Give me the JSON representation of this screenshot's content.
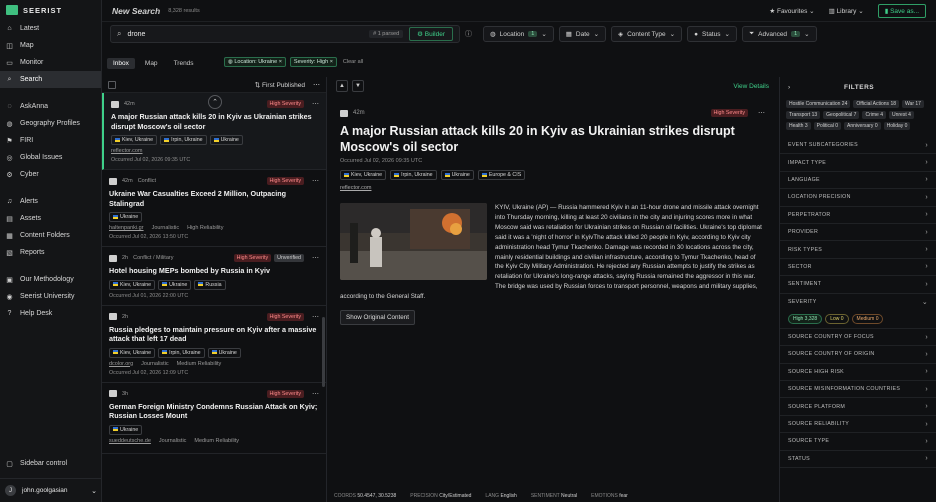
{
  "app": {
    "logo": "SEERIST"
  },
  "nav": {
    "items": [
      {
        "label": "Latest",
        "icon": "home-icon"
      },
      {
        "label": "Map",
        "icon": "map-icon"
      },
      {
        "label": "Monitor",
        "icon": "monitor-icon"
      },
      {
        "label": "Search",
        "icon": "search-icon"
      }
    ],
    "items2": [
      {
        "label": "AskAnna",
        "icon": "chat-icon"
      },
      {
        "label": "Geography Profiles",
        "icon": "globe-icon"
      },
      {
        "label": "FIRI",
        "icon": "flag-icon"
      },
      {
        "label": "Global Issues",
        "icon": "issues-icon"
      },
      {
        "label": "Cyber",
        "icon": "cyber-icon"
      }
    ],
    "items3": [
      {
        "label": "Alerts",
        "icon": "bell-icon"
      },
      {
        "label": "Assets",
        "icon": "asset-icon"
      },
      {
        "label": "Content Folders",
        "icon": "folder-icon"
      },
      {
        "label": "Reports",
        "icon": "report-icon"
      }
    ],
    "items4": [
      {
        "label": "Our Methodology",
        "icon": "book-icon"
      },
      {
        "label": "Seerist University",
        "icon": "university-icon"
      },
      {
        "label": "Help Desk",
        "icon": "help-icon"
      }
    ],
    "sidebar_control": "Sidebar control",
    "user_initial": "J",
    "user_name": "john.goolgasian"
  },
  "topbar": {
    "title": "New Search",
    "count": "8,328 results",
    "favourites": "Favourites",
    "library": "Library",
    "save": "Save as..."
  },
  "search": {
    "query": "drone",
    "parsed": "1 parsed",
    "builder": "Builder",
    "filters": [
      {
        "label": "Location",
        "count": "1"
      },
      {
        "label": "Date",
        "count": ""
      },
      {
        "label": "Content Type",
        "count": ""
      },
      {
        "label": "Status",
        "count": ""
      },
      {
        "label": "Advanced",
        "count": "1"
      }
    ]
  },
  "tabs": [
    "Inbox",
    "Map",
    "Trends"
  ],
  "active_filters": {
    "location": "Location: Ukraine",
    "severity": "Severity: High",
    "clear": "Clear all"
  },
  "list": {
    "sort": "First Published",
    "cards": [
      {
        "age": "42m",
        "type": "",
        "severity": "High Severity",
        "unverified": "",
        "title": "A major Russian attack kills 20 in Kyiv as Ukrainian strikes disrupt Moscow's oil sector",
        "locations": [
          "Kiev, Ukraine",
          "Irpin, Ukraine",
          "Ukraine"
        ],
        "source": "reflector.com",
        "tag1": "",
        "tag2": "",
        "occurred": "Occurred  Jul 02, 2026 09:35 UTC"
      },
      {
        "age": "42m",
        "type": "Conflict",
        "severity": "High Severity",
        "unverified": "",
        "title": "Ukraine War Casualties Exceed 2 Million, Outpacing Stalingrad",
        "locations": [
          "Ukraine"
        ],
        "source": "haltenpanki.gr",
        "tag1": "Journalistic",
        "tag2": "High Reliability",
        "occurred": "Occurred  Jul 02, 2026 13:50 UTC"
      },
      {
        "age": "2h",
        "type": "Conflict / Military",
        "severity": "High Severity",
        "unverified": "Unverified",
        "title": "Hotel housing MEPs bombed by Russia in Kyiv",
        "locations": [
          "Kiev, Ukraine",
          "Ukraine",
          "Russia"
        ],
        "source": "",
        "tag1": "",
        "tag2": "",
        "occurred": "Occurred  Jul 01, 2026 22:00 UTC"
      },
      {
        "age": "2h",
        "type": "",
        "severity": "High Severity",
        "unverified": "",
        "title": "Russia pledges to maintain pressure on Kyiv after a massive attack that left 17 dead",
        "locations": [
          "Kiev, Ukraine",
          "Irpin, Ukraine",
          "Ukraine"
        ],
        "source": "dcolor.org",
        "tag1": "Journalistic",
        "tag2": "Medium Reliability",
        "occurred": "Occurred  Jul 02, 2026 12:09 UTC"
      },
      {
        "age": "3h",
        "type": "",
        "severity": "High Severity",
        "unverified": "",
        "title": "German Foreign Ministry Condemns Russian Attack on Kyiv; Russian Losses Mount",
        "locations": [
          "Ukraine"
        ],
        "source": "sueddeutsche.de",
        "tag1": "Journalistic",
        "tag2": "Medium Reliability",
        "occurred": ""
      }
    ]
  },
  "detail": {
    "view_details": "View Details",
    "age": "42m",
    "severity": "High Severity",
    "title": "A major Russian attack kills 20 in Kyiv as Ukrainian strikes disrupt Moscow's oil sector",
    "occurred": "Occurred  Jul 02, 2026 09:35 UTC",
    "locations": [
      "Kiev, Ukraine",
      "Irpin, Ukraine",
      "Ukraine",
      "Europe & CIS"
    ],
    "source": "reflector.com",
    "body": "KYIV, Ukraine (AP) — Russia hammered Kyiv in an 11-hour drone and missile attack overnight into Thursday morning, killing at least 20 civilians in the city and injuring scores more in what Moscow said was retaliation for Ukrainian strikes on Russian oil facilities. Ukraine's top diplomat said it was a 'night of horror' in KyivThe attack killed 20 people in Kyiv, according to Kyiv city administration head Tymur Tkachenko. Damage was recorded in 30 locations across the city, mainly residential buildings and civilian infrastructure, according to Tymur Tkachenko, head of the Kyiv City Military Administration. He rejected any Russian attempts to justify the strikes as retaliation for Ukraine's long-range attacks, saying Russia remained the aggressor in this war. The bridge was used by Russian forces to transport personnel, weapons and military supplies, according to the General Staff.",
    "show_original": "Show Original Content",
    "status": {
      "coords_label": "COORDS",
      "coords": "50.4547, 30.5238",
      "precision_label": "PRECISION",
      "precision": "City/Estimated",
      "lang_label": "LANG",
      "lang": "English",
      "sentiment_label": "SENTIMENT",
      "sentiment": "Neutral",
      "emotions_label": "EMOTIONS",
      "emotions": "fear"
    }
  },
  "filters": {
    "title": "FILTERS",
    "topics": [
      "Hostile Communication 24",
      "Official Actions 18",
      "War 17",
      "Transport 13",
      "Geopolitical 7",
      "Crime 4",
      "Unrest 4",
      "Health 3",
      "Political 0",
      "Anniversary 0",
      "Holiday 0"
    ],
    "rows_a": [
      "EVENT SUBCATEGORIES",
      "IMPACT TYPE",
      "LANGUAGE",
      "LOCATION PRECISION",
      "PERPETRATOR",
      "PROVIDER",
      "RISK TYPES",
      "SECTOR",
      "SENTIMENT"
    ],
    "severity_label": "SEVERITY",
    "severity_chips": {
      "high": "High 3,328",
      "low": "Low 0",
      "med": "Medium 0"
    },
    "rows_b": [
      "SOURCE COUNTRY OF FOCUS",
      "SOURCE COUNTRY OF ORIGIN",
      "SOURCE HIGH RISK",
      "SOURCE MISINFORMATION COUNTRIES",
      "SOURCE PLATFORM",
      "SOURCE RELIABILITY",
      "SOURCE TYPE",
      "STATUS"
    ]
  }
}
